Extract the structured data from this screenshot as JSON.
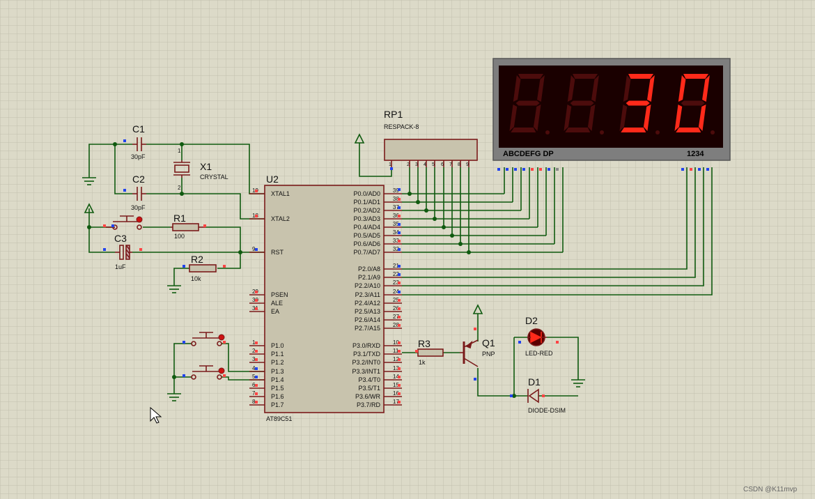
{
  "colors": {
    "background": "#dcdac8",
    "grid": "#c2c0ae",
    "wire": "#0f5a0f",
    "component": "#7a1a1a",
    "chip_fill": "#c8c3ad",
    "display_frame": "#7e7e7e",
    "segment_on": "#ff2a1a",
    "segment_off": "#4c0c0c",
    "pin_red": "#ff4444",
    "pin_blue": "#2244ee"
  },
  "components": {
    "c1": {
      "ref": "C1",
      "value": "30pF"
    },
    "c2": {
      "ref": "C2",
      "value": "30pF"
    },
    "c3": {
      "ref": "C3",
      "value": "1uF"
    },
    "x1": {
      "ref": "X1",
      "value": "CRYSTAL",
      "pin_top": "1",
      "pin_bottom": "2"
    },
    "r1": {
      "ref": "R1",
      "value": "100"
    },
    "r2": {
      "ref": "R2",
      "value": "10k"
    },
    "r3": {
      "ref": "R3",
      "value": "1k"
    },
    "rp1": {
      "ref": "RP1",
      "value": "RESPACK-8",
      "pins": [
        "1",
        "2",
        "3",
        "4",
        "5",
        "6",
        "7",
        "8",
        "9"
      ]
    },
    "q1": {
      "ref": "Q1",
      "value": "PNP"
    },
    "d1": {
      "ref": "D1",
      "value": "DIODE-DSIM"
    },
    "d2": {
      "ref": "D2",
      "value": "LED-RED"
    },
    "u2": {
      "ref": "U2",
      "part": "AT89C51"
    }
  },
  "mcu": {
    "left_pins": [
      {
        "num": "19",
        "name": "XTAL1"
      },
      {
        "num": "18",
        "name": "XTAL2"
      },
      {
        "num": "9",
        "name": "RST"
      },
      {
        "num": "29",
        "name": "PSEN"
      },
      {
        "num": "30",
        "name": "ALE"
      },
      {
        "num": "31",
        "name": "EA"
      },
      {
        "num": "1",
        "name": "P1.0"
      },
      {
        "num": "2",
        "name": "P1.1"
      },
      {
        "num": "3",
        "name": "P1.2"
      },
      {
        "num": "4",
        "name": "P1.3"
      },
      {
        "num": "5",
        "name": "P1.4"
      },
      {
        "num": "6",
        "name": "P1.5"
      },
      {
        "num": "7",
        "name": "P1.6"
      },
      {
        "num": "8",
        "name": "P1.7"
      }
    ],
    "right_pins": [
      {
        "num": "39",
        "name": "P0.0/AD0"
      },
      {
        "num": "38",
        "name": "P0.1/AD1"
      },
      {
        "num": "37",
        "name": "P0.2/AD2"
      },
      {
        "num": "36",
        "name": "P0.3/AD3"
      },
      {
        "num": "35",
        "name": "P0.4/AD4"
      },
      {
        "num": "34",
        "name": "P0.5/AD5"
      },
      {
        "num": "33",
        "name": "P0.6/AD6"
      },
      {
        "num": "32",
        "name": "P0.7/AD7"
      },
      {
        "num": "21",
        "name": "P2.0/A8"
      },
      {
        "num": "22",
        "name": "P2.1/A9"
      },
      {
        "num": "23",
        "name": "P2.2/A10"
      },
      {
        "num": "24",
        "name": "P2.3/A11"
      },
      {
        "num": "25",
        "name": "P2.4/A12"
      },
      {
        "num": "26",
        "name": "P2.5/A13"
      },
      {
        "num": "27",
        "name": "P2.6/A14"
      },
      {
        "num": "28",
        "name": "P2.7/A15"
      },
      {
        "num": "10",
        "name": "P3.0/RXD"
      },
      {
        "num": "11",
        "name": "P3.1/TXD"
      },
      {
        "num": "12",
        "name": "P3.2/INT0"
      },
      {
        "num": "13",
        "name": "P3.3/INT1"
      },
      {
        "num": "14",
        "name": "P3.4/T0"
      },
      {
        "num": "15",
        "name": "P3.5/T1"
      },
      {
        "num": "16",
        "name": "P3.6/WR"
      },
      {
        "num": "17",
        "name": "P3.7/RD"
      }
    ]
  },
  "display": {
    "digits": [
      "",
      "",
      "3",
      "0"
    ],
    "segment_label": "ABCDEFG  DP",
    "digit_label": "1234"
  },
  "watermark": "CSDN @K11mvp"
}
